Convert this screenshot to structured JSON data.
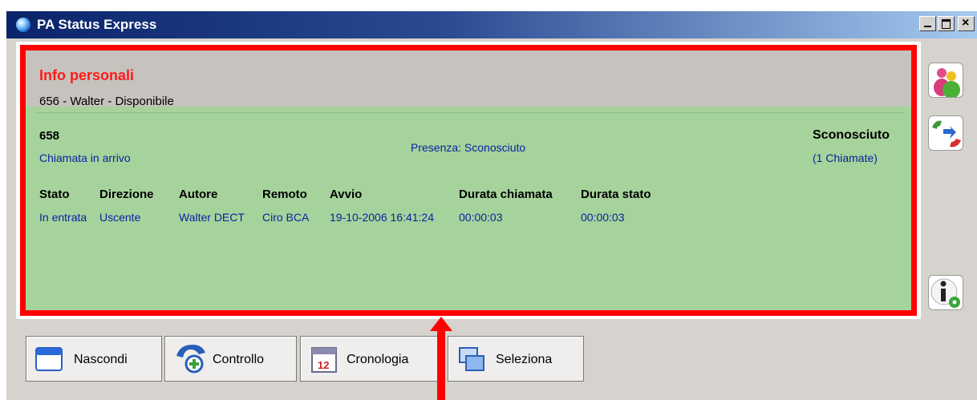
{
  "window": {
    "title": "PA Status Express"
  },
  "info": {
    "title": "Info personali",
    "subtitle": "656 - Walter - Disponibile"
  },
  "call": {
    "number": "658",
    "type": "Chiamata in arrivo",
    "presence": "Presenza:  Sconosciuto",
    "caller_status": "Sconosciuto",
    "call_count": "(1 Chiamate)"
  },
  "table": {
    "headers": [
      "Stato",
      "Direzione",
      "Autore",
      "Remoto",
      "Avvio",
      "Durata chiamata",
      "Durata stato"
    ],
    "row": [
      "In entrata",
      "Uscente",
      "Walter DECT",
      "Ciro BCA",
      "19-10-2006 16:41:24",
      "00:00:03",
      "00:00:03"
    ]
  },
  "buttons": {
    "hide": "Nascondi",
    "control": "Controllo",
    "history": "Cronologia",
    "select": "Seleziona"
  },
  "icons": [
    "app-globe-icon",
    "contacts-icon",
    "transfer-call-icon",
    "info-settings-icon",
    "window-icon",
    "phone-search-icon",
    "calendar-icon",
    "select-icon"
  ]
}
